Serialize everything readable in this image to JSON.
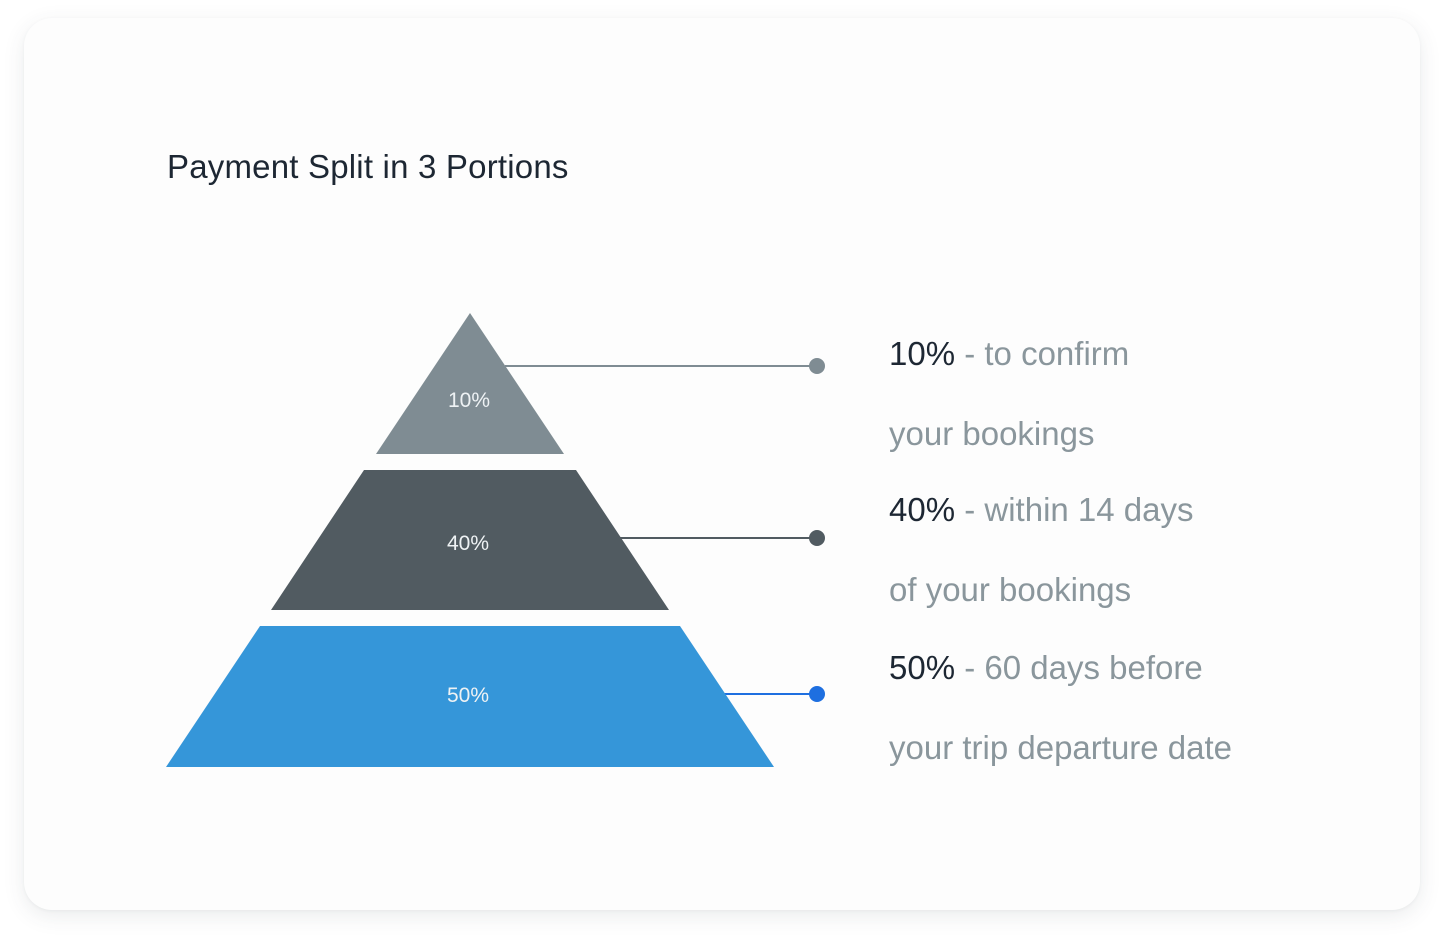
{
  "title": "Payment Split in 3 Portions",
  "colors": {
    "tier_top": "#7f8c93",
    "tier_middle": "#515b61",
    "tier_bottom": "#3596d9",
    "connector_top": "#7f8c93",
    "connector_middle": "#515b61",
    "connector_bottom": "#1e6fe0",
    "text_dark": "#1d2733",
    "text_muted": "#8a969c"
  },
  "tiers": [
    {
      "id": "top",
      "label": "10%",
      "value": 10,
      "percent_text": "10%",
      "separator": " - ",
      "line1": "to confirm",
      "line2": "your bookings"
    },
    {
      "id": "middle",
      "label": "40%",
      "value": 40,
      "percent_text": "40%",
      "separator": " - ",
      "line1": "within 14 days",
      "line2": "of your bookings"
    },
    {
      "id": "bottom",
      "label": "50%",
      "value": 50,
      "percent_text": "50%",
      "separator": " - ",
      "line1": "60 days before",
      "line2": "your trip departure date"
    }
  ]
}
